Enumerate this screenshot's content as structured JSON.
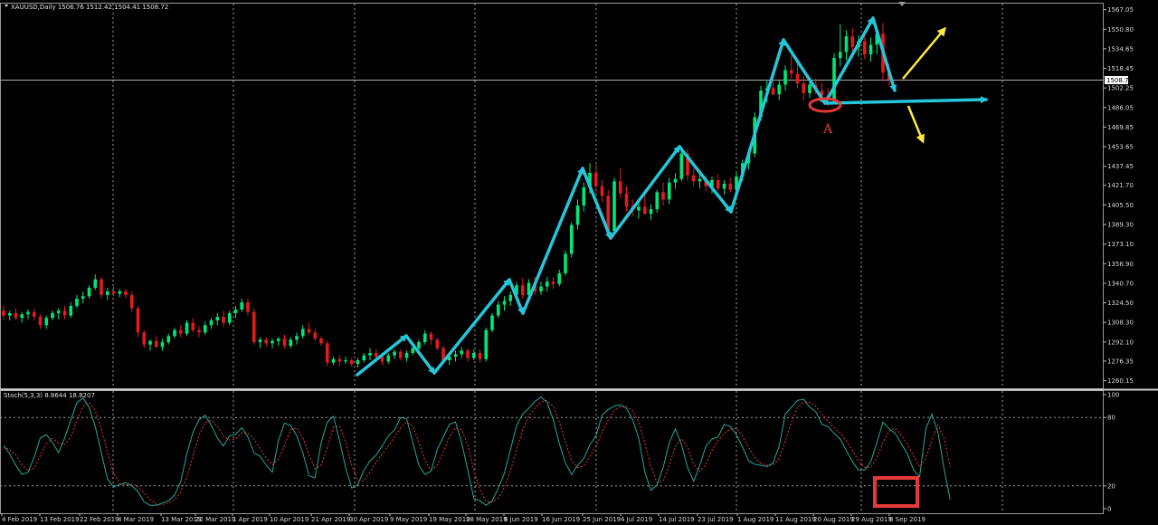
{
  "chart_data": {
    "type": "candlestick",
    "instrument": "XAUUSD",
    "timeframe": "Daily",
    "header": {
      "text": "XAUUSD,Daily  1506.76 1512.42 1504.41 1508.72"
    },
    "colors": {
      "background": "#000000",
      "bull_candle": "#00e676",
      "bear_candle": "#e31b1b",
      "grid": "#bbbbbb",
      "axis_text": "#d8d8d8",
      "current_price_line": "#aaaaaa",
      "trend_arrows": "#26c6da",
      "projection_arrows": "#ffeb3b",
      "stoch_main": "#26a69a",
      "stoch_signal": "#e53935",
      "highlight": "#e53935"
    },
    "price_axis": {
      "ylim": [
        1253.8,
        1572.0
      ],
      "ticks": [
        "1567.05",
        "1550.80",
        "1534.65",
        "1518.45",
        "1502.25",
        "1486.05",
        "1469.85",
        "1453.65",
        "1437.45",
        "1421.70",
        "1405.50",
        "1389.30",
        "1373.10",
        "1356.90",
        "1340.70",
        "1324.50",
        "1308.30",
        "1292.10",
        "1276.35",
        "1260.15"
      ],
      "current_price": "1508.72"
    },
    "date_axis": {
      "ticks": [
        "4 Feb 2019",
        "13 Feb 2019",
        "22 Feb 2019",
        "4 Mar 2019",
        "13 Mar 2019",
        "22 Mar 2019",
        "1 Apr 2019",
        "10 Apr 2019",
        "21 Apr 2019",
        "30 Apr 2019",
        "9 May 2019",
        "19 May 2019",
        "28 May 2019",
        "6 Jun 2019",
        "16 Jun 2019",
        "25 Jun 2019",
        "4 Jul 2019",
        "14 Jul 2019",
        "23 Jul 2019",
        "1 Aug 2019",
        "11 Aug 2019",
        "20 Aug 2019",
        "29 Aug 2019",
        "8 Sep 2019"
      ]
    },
    "candles": [
      [
        1318,
        1322,
        1311,
        1314
      ],
      [
        1314,
        1318,
        1310,
        1316
      ],
      [
        1316,
        1320,
        1310,
        1312
      ],
      [
        1312,
        1317,
        1308,
        1315
      ],
      [
        1315,
        1319,
        1311,
        1317
      ],
      [
        1317,
        1320,
        1310,
        1313
      ],
      [
        1313,
        1315,
        1303,
        1306
      ],
      [
        1306,
        1314,
        1303,
        1312
      ],
      [
        1312,
        1318,
        1310,
        1316
      ],
      [
        1316,
        1320,
        1311,
        1318
      ],
      [
        1318,
        1322,
        1311,
        1314
      ],
      [
        1314,
        1325,
        1312,
        1322
      ],
      [
        1322,
        1331,
        1320,
        1328
      ],
      [
        1328,
        1334,
        1324,
        1330
      ],
      [
        1330,
        1339,
        1328,
        1337
      ],
      [
        1337,
        1348,
        1335,
        1344
      ],
      [
        1344,
        1346,
        1328,
        1331
      ],
      [
        1331,
        1337,
        1327,
        1334
      ],
      [
        1334,
        1338,
        1330,
        1332
      ],
      [
        1332,
        1336,
        1329,
        1334
      ],
      [
        1334,
        1336,
        1328,
        1331
      ],
      [
        1331,
        1334,
        1317,
        1320
      ],
      [
        1320,
        1322,
        1296,
        1300
      ],
      [
        1300,
        1302,
        1287,
        1290
      ],
      [
        1290,
        1294,
        1285,
        1293
      ],
      [
        1293,
        1297,
        1287,
        1288
      ],
      [
        1288,
        1295,
        1285,
        1292
      ],
      [
        1292,
        1299,
        1290,
        1297
      ],
      [
        1297,
        1304,
        1295,
        1302
      ],
      [
        1302,
        1306,
        1296,
        1299
      ],
      [
        1299,
        1310,
        1297,
        1308
      ],
      [
        1308,
        1312,
        1300,
        1302
      ],
      [
        1302,
        1305,
        1296,
        1300
      ],
      [
        1300,
        1309,
        1298,
        1306
      ],
      [
        1306,
        1312,
        1303,
        1310
      ],
      [
        1310,
        1316,
        1306,
        1313
      ],
      [
        1313,
        1318,
        1305,
        1308
      ],
      [
        1308,
        1318,
        1306,
        1316
      ],
      [
        1316,
        1322,
        1312,
        1319
      ],
      [
        1319,
        1328,
        1317,
        1325
      ],
      [
        1325,
        1328,
        1314,
        1317
      ],
      [
        1317,
        1320,
        1290,
        1292
      ],
      [
        1292,
        1296,
        1287,
        1294
      ],
      [
        1294,
        1296,
        1288,
        1291
      ],
      [
        1291,
        1295,
        1287,
        1293
      ],
      [
        1293,
        1296,
        1289,
        1295
      ],
      [
        1295,
        1298,
        1287,
        1289
      ],
      [
        1289,
        1296,
        1287,
        1294
      ],
      [
        1294,
        1300,
        1290,
        1297
      ],
      [
        1297,
        1306,
        1295,
        1303
      ],
      [
        1303,
        1308,
        1298,
        1300
      ],
      [
        1300,
        1303,
        1293,
        1295
      ],
      [
        1295,
        1297,
        1289,
        1291
      ],
      [
        1291,
        1293,
        1272,
        1275
      ],
      [
        1275,
        1280,
        1273,
        1278
      ],
      [
        1278,
        1281,
        1272,
        1276
      ],
      [
        1276,
        1280,
        1274,
        1277
      ],
      [
        1277,
        1279,
        1272,
        1274
      ],
      [
        1274,
        1279,
        1271,
        1277
      ],
      [
        1277,
        1283,
        1275,
        1281
      ],
      [
        1281,
        1287,
        1277,
        1283
      ],
      [
        1283,
        1286,
        1276,
        1280
      ],
      [
        1280,
        1282,
        1273,
        1276
      ],
      [
        1276,
        1283,
        1274,
        1281
      ],
      [
        1281,
        1286,
        1278,
        1284
      ],
      [
        1284,
        1286,
        1277,
        1279
      ],
      [
        1279,
        1285,
        1276,
        1283
      ],
      [
        1283,
        1290,
        1281,
        1287
      ],
      [
        1287,
        1294,
        1285,
        1292
      ],
      [
        1292,
        1302,
        1290,
        1299
      ],
      [
        1299,
        1301,
        1290,
        1294
      ],
      [
        1294,
        1296,
        1285,
        1287
      ],
      [
        1287,
        1289,
        1274,
        1277
      ],
      [
        1277,
        1283,
        1273,
        1280
      ],
      [
        1280,
        1285,
        1276,
        1282
      ],
      [
        1282,
        1288,
        1279,
        1285
      ],
      [
        1285,
        1287,
        1276,
        1279
      ],
      [
        1279,
        1286,
        1277,
        1283
      ],
      [
        1283,
        1286,
        1275,
        1278
      ],
      [
        1278,
        1304,
        1276,
        1302
      ],
      [
        1302,
        1316,
        1300,
        1314
      ],
      [
        1314,
        1326,
        1312,
        1323
      ],
      [
        1323,
        1330,
        1318,
        1326
      ],
      [
        1326,
        1334,
        1322,
        1331
      ],
      [
        1331,
        1342,
        1328,
        1339
      ],
      [
        1339,
        1345,
        1328,
        1331
      ],
      [
        1331,
        1344,
        1329,
        1341
      ],
      [
        1341,
        1346,
        1331,
        1334
      ],
      [
        1334,
        1342,
        1331,
        1338
      ],
      [
        1338,
        1346,
        1334,
        1342
      ],
      [
        1342,
        1346,
        1336,
        1340
      ],
      [
        1340,
        1352,
        1338,
        1349
      ],
      [
        1349,
        1368,
        1347,
        1365
      ],
      [
        1365,
        1391,
        1362,
        1389
      ],
      [
        1389,
        1410,
        1385,
        1405
      ],
      [
        1405,
        1424,
        1400,
        1420
      ],
      [
        1420,
        1440,
        1415,
        1432
      ],
      [
        1432,
        1439,
        1415,
        1421
      ],
      [
        1421,
        1426,
        1408,
        1413
      ],
      [
        1413,
        1418,
        1378,
        1384
      ],
      [
        1384,
        1428,
        1382,
        1425
      ],
      [
        1425,
        1436,
        1411,
        1415
      ],
      [
        1415,
        1421,
        1400,
        1404
      ],
      [
        1404,
        1410,
        1396,
        1401
      ],
      [
        1401,
        1408,
        1394,
        1404
      ],
      [
        1404,
        1414,
        1399,
        1398
      ],
      [
        1398,
        1406,
        1393,
        1402
      ],
      [
        1402,
        1418,
        1399,
        1416
      ],
      [
        1416,
        1424,
        1405,
        1410
      ],
      [
        1410,
        1428,
        1406,
        1424
      ],
      [
        1424,
        1432,
        1419,
        1427
      ],
      [
        1427,
        1454,
        1425,
        1448
      ],
      [
        1448,
        1452,
        1426,
        1430
      ],
      [
        1430,
        1436,
        1421,
        1425
      ],
      [
        1425,
        1431,
        1419,
        1427
      ],
      [
        1427,
        1430,
        1417,
        1421
      ],
      [
        1421,
        1429,
        1415,
        1426
      ],
      [
        1426,
        1431,
        1417,
        1419
      ],
      [
        1419,
        1426,
        1414,
        1423
      ],
      [
        1423,
        1428,
        1416,
        1418
      ],
      [
        1418,
        1433,
        1414,
        1429
      ],
      [
        1429,
        1443,
        1425,
        1440
      ],
      [
        1440,
        1452,
        1435,
        1448
      ],
      [
        1448,
        1482,
        1445,
        1478
      ],
      [
        1478,
        1504,
        1475,
        1500
      ],
      [
        1500,
        1509,
        1490,
        1502
      ],
      [
        1502,
        1514,
        1496,
        1497
      ],
      [
        1497,
        1509,
        1492,
        1505
      ],
      [
        1505,
        1521,
        1500,
        1517
      ],
      [
        1517,
        1529,
        1510,
        1514
      ],
      [
        1514,
        1522,
        1502,
        1506
      ],
      [
        1506,
        1512,
        1492,
        1498
      ],
      [
        1498,
        1508,
        1494,
        1505
      ],
      [
        1505,
        1510,
        1497,
        1500
      ],
      [
        1500,
        1506,
        1491,
        1496
      ],
      [
        1496,
        1502,
        1487,
        1493
      ],
      [
        1493,
        1531,
        1490,
        1527
      ],
      [
        1527,
        1555,
        1520,
        1532
      ],
      [
        1532,
        1550,
        1525,
        1545
      ],
      [
        1545,
        1552,
        1530,
        1536
      ],
      [
        1536,
        1546,
        1528,
        1541
      ],
      [
        1541,
        1546,
        1526,
        1530
      ],
      [
        1530,
        1544,
        1524,
        1538
      ],
      [
        1538,
        1552,
        1530,
        1547
      ],
      [
        1547,
        1556,
        1508,
        1515
      ],
      [
        1515,
        1522,
        1504,
        1509
      ]
    ],
    "trend_arrows": [
      [
        [
          395,
          414
        ],
        [
          449,
          371
        ]
      ],
      [
        [
          449,
          371
        ],
        [
          480,
          412
        ]
      ],
      [
        [
          480,
          412
        ],
        [
          563,
          309
        ]
      ],
      [
        [
          563,
          309
        ],
        [
          578,
          346
        ]
      ],
      [
        [
          578,
          346
        ],
        [
          644,
          186
        ]
      ],
      [
        [
          644,
          186
        ],
        [
          675,
          263
        ]
      ],
      [
        [
          675,
          263
        ],
        [
          751,
          162
        ]
      ],
      [
        [
          751,
          162
        ],
        [
          808,
          234
        ]
      ],
      [
        [
          808,
          234
        ],
        [
          866,
          44
        ]
      ],
      [
        [
          866,
          44
        ],
        [
          912,
          114
        ]
      ],
      [
        [
          912,
          114
        ],
        [
          965,
          20
        ]
      ],
      [
        [
          965,
          20
        ],
        [
          989,
          100
        ]
      ],
      [
        [
          912,
          114
        ],
        [
          1090,
          110
        ]
      ]
    ],
    "projection_arrows": [
      [
        [
          998,
          87
        ],
        [
          1044,
          32
        ]
      ],
      [
        [
          1004,
          117
        ],
        [
          1020,
          156
        ]
      ]
    ],
    "annotation": {
      "label": "A"
    },
    "stochastic": {
      "legend": "Stoch(5,3,3) 8.8644 18.8207",
      "ylim": [
        0,
        100
      ],
      "ticks": [
        "100",
        "80",
        "20",
        "0"
      ],
      "levels": [
        80,
        20
      ],
      "main": [
        55,
        48,
        38,
        30,
        32,
        45,
        62,
        65,
        58,
        49,
        62,
        78,
        93,
        97,
        89,
        72,
        49,
        26,
        19,
        21,
        23,
        20,
        15,
        6,
        3,
        3,
        5,
        7,
        12,
        24,
        48,
        67,
        78,
        82,
        73,
        62,
        55,
        64,
        65,
        71,
        63,
        49,
        46,
        38,
        32,
        60,
        75,
        73,
        64,
        49,
        29,
        27,
        58,
        76,
        81,
        60,
        36,
        18,
        21,
        34,
        42,
        47,
        55,
        64,
        69,
        80,
        79,
        58,
        38,
        30,
        33,
        52,
        63,
        74,
        76,
        58,
        34,
        9,
        7,
        3,
        7,
        18,
        31,
        52,
        73,
        83,
        88,
        94,
        98,
        93,
        78,
        57,
        40,
        30,
        38,
        44,
        56,
        64,
        82,
        87,
        90,
        91,
        88,
        78,
        62,
        32,
        16,
        21,
        36,
        58,
        70,
        56,
        36,
        24,
        38,
        55,
        61,
        63,
        74,
        72,
        65,
        54,
        42,
        39,
        38,
        37,
        40,
        55,
        83,
        89,
        95,
        96,
        89,
        85,
        74,
        72,
        66,
        61,
        51,
        41,
        34,
        34,
        41,
        58,
        76,
        70,
        66,
        57,
        48,
        34,
        28,
        70,
        83,
        67,
        35,
        8
      ]
    },
    "highlight_box": {}
  }
}
